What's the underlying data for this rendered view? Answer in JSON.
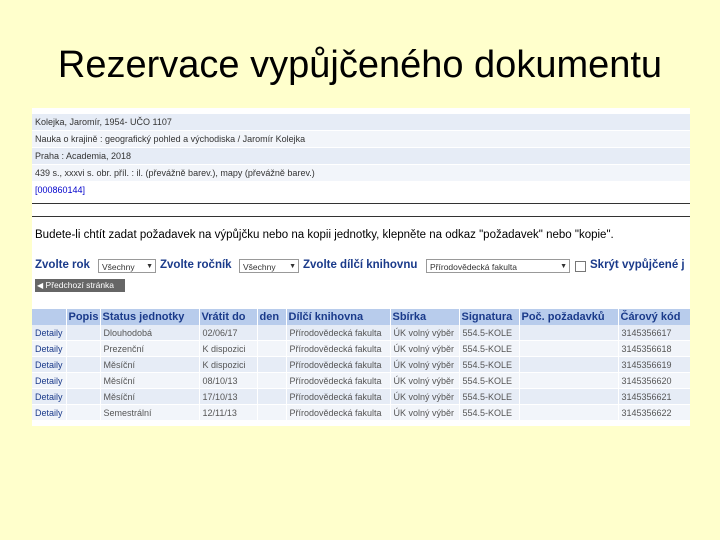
{
  "slide": {
    "title": "Rezervace vypůjčeného dokumentu"
  },
  "record": {
    "lines": [
      "Kolejka, Jaromír, 1954- UČO 1107",
      "Nauka o krajině : geografický pohled a východiska / Jaromír Kolejka",
      "Praha : Academia, 2018",
      "439 s., xxxvi s. obr. příl. : il. (převážně barev.), mapy (převážně barev.)",
      "[000860144]"
    ]
  },
  "notice": "Budete-li chtít zadat požadavek na výpůjčku nebo na kopii jednotky, klepněte na odkaz \"požadavek\" nebo \"kopie\".",
  "filters": {
    "year_label": "Zvolte rok",
    "year_value": "Všechny",
    "volume_label": "Zvolte ročník",
    "volume_value": "Všechny",
    "sublib_label": "Zvolte dílčí knihovnu",
    "sublib_value": "Přírodovědecká fakulta",
    "hide_label": "Skrýt vypůjčené j"
  },
  "prev_page": "Předchozí stránka",
  "table": {
    "headers": [
      "",
      "Popis",
      "Status jednotky",
      "Vrátit do",
      "den",
      "Dílčí knihovna",
      "Sbírka",
      "Signatura",
      "Poč. požadavků",
      "Čárový kód"
    ],
    "rows": [
      [
        "Detaily",
        "",
        "Dlouhodobá",
        "02/06/17",
        "",
        "Přírodovědecká fakulta",
        "ÚK volný výběr",
        "554.5-KOLE",
        "",
        "3145356617"
      ],
      [
        "Detaily",
        "",
        "Prezenční",
        "K dispozici",
        "",
        "Přírodovědecká fakulta",
        "ÚK volný výběr",
        "554.5-KOLE",
        "",
        "3145356618"
      ],
      [
        "Detaily",
        "",
        "Měsíční",
        "K dispozici",
        "",
        "Přírodovědecká fakulta",
        "ÚK volný výběr",
        "554.5-KOLE",
        "",
        "3145356619"
      ],
      [
        "Detaily",
        "",
        "Měsíční",
        "08/10/13",
        "",
        "Přírodovědecká fakulta",
        "ÚK volný výběr",
        "554.5-KOLE",
        "",
        "3145356620"
      ],
      [
        "Detaily",
        "",
        "Měsíční",
        "17/10/13",
        "",
        "Přírodovědecká fakulta",
        "ÚK volný výběr",
        "554.5-KOLE",
        "",
        "3145356621"
      ],
      [
        "Detaily",
        "",
        "Semestrální",
        "12/11/13",
        "",
        "Přírodovědecká fakulta",
        "ÚK volný výběr",
        "554.5-KOLE",
        "",
        "3145356622"
      ]
    ]
  }
}
